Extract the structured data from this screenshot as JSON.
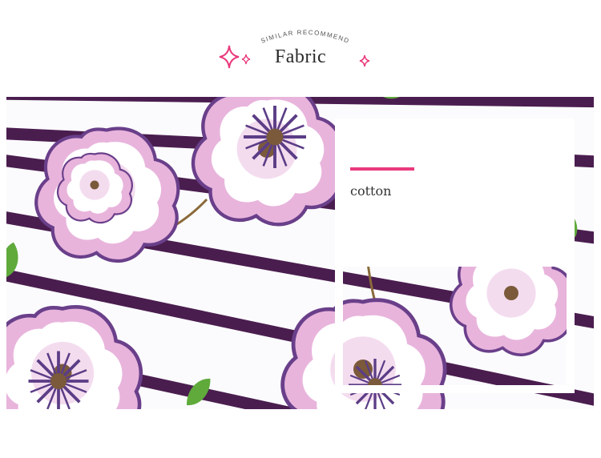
{
  "header": {
    "subtitle": "SIMILAR RECOMMEND",
    "title": "Fabric"
  },
  "fabric": {
    "material": "cotton"
  },
  "colors": {
    "accent": "#e93a7d",
    "stripe": "#4a1d4f",
    "petal_pink": "#e8b4dc",
    "petal_lavender": "#c9a3d8",
    "leaf_green": "#5faa3b"
  },
  "icons": [
    "sparkle-icon",
    "sparkle-icon",
    "sparkle-icon"
  ]
}
